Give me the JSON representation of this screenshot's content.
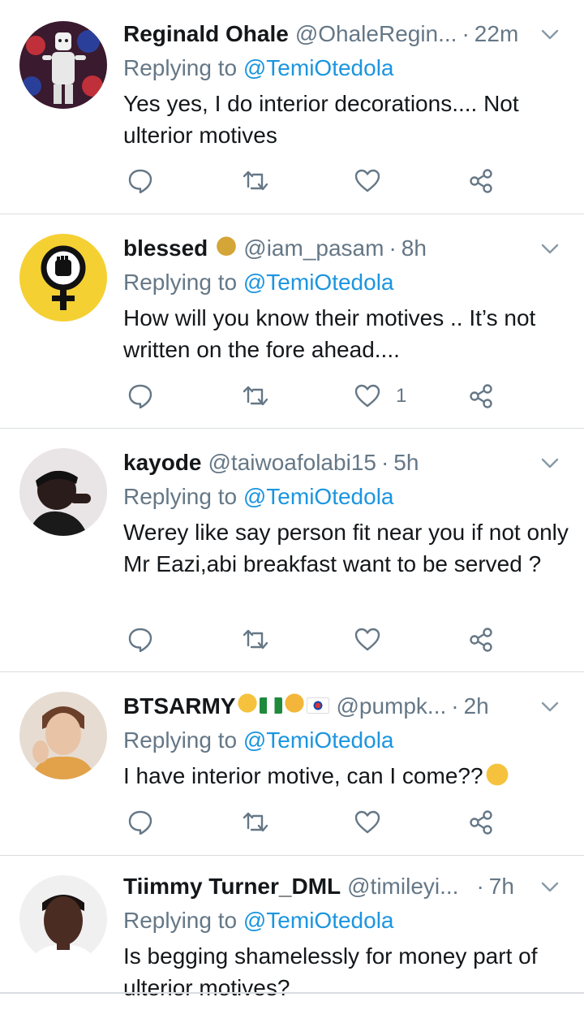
{
  "colors": {
    "accent": "#1b95e0",
    "muted": "#657786",
    "text": "#14171a",
    "divider": "#d8dde1"
  },
  "replying_prefix": "Replying to",
  "tweets": [
    {
      "name": "Reginald Ohale",
      "handle": "@OhaleRegin...",
      "time": "22m",
      "mention": "@TemiOtedola",
      "text": "Yes yes, I do interior decorations.... Not ulterior motives",
      "likes": "",
      "avatar": "marshmello-avatar"
    },
    {
      "name": "blessed",
      "handle": "@iam_pasam",
      "time": "8h",
      "mention": "@TemiOtedola",
      "text": "How will you know their motives .. It’s not written on the fore ahead....",
      "likes": "1",
      "avatar": "female-fist-symbol-avatar",
      "name_emoji": [
        "money-bag-emoji"
      ]
    },
    {
      "name": "kayode",
      "handle": "@taiwoafolabi15",
      "time": "5h",
      "mention": "@TemiOtedola",
      "text": "Werey like say person fit near you if not only Mr Eazi,abi breakfast want to be served ?",
      "likes": "",
      "avatar": "person-photo-avatar"
    },
    {
      "name": "BTSARMY",
      "handle": "@pumpk...",
      "time": "2h",
      "mention": "@TemiOtedola",
      "text": "I have interior motive, can I come??",
      "likes": "",
      "avatar": "person-photo-avatar",
      "name_emoji": [
        "hugging-face-emoji",
        "nigeria-flag-emoji",
        "cat-face-emoji",
        "south-korea-flag-emoji"
      ],
      "text_emoji": "pleading-face-emoji"
    },
    {
      "name": "Tiimmy Turner_DML",
      "handle": "@timileyi...",
      "time": "7h",
      "mention": "@TemiOtedola",
      "text": "Is begging shamelessly for money part of ulterior motives?",
      "likes": "",
      "avatar": "person-photo-avatar"
    }
  ]
}
